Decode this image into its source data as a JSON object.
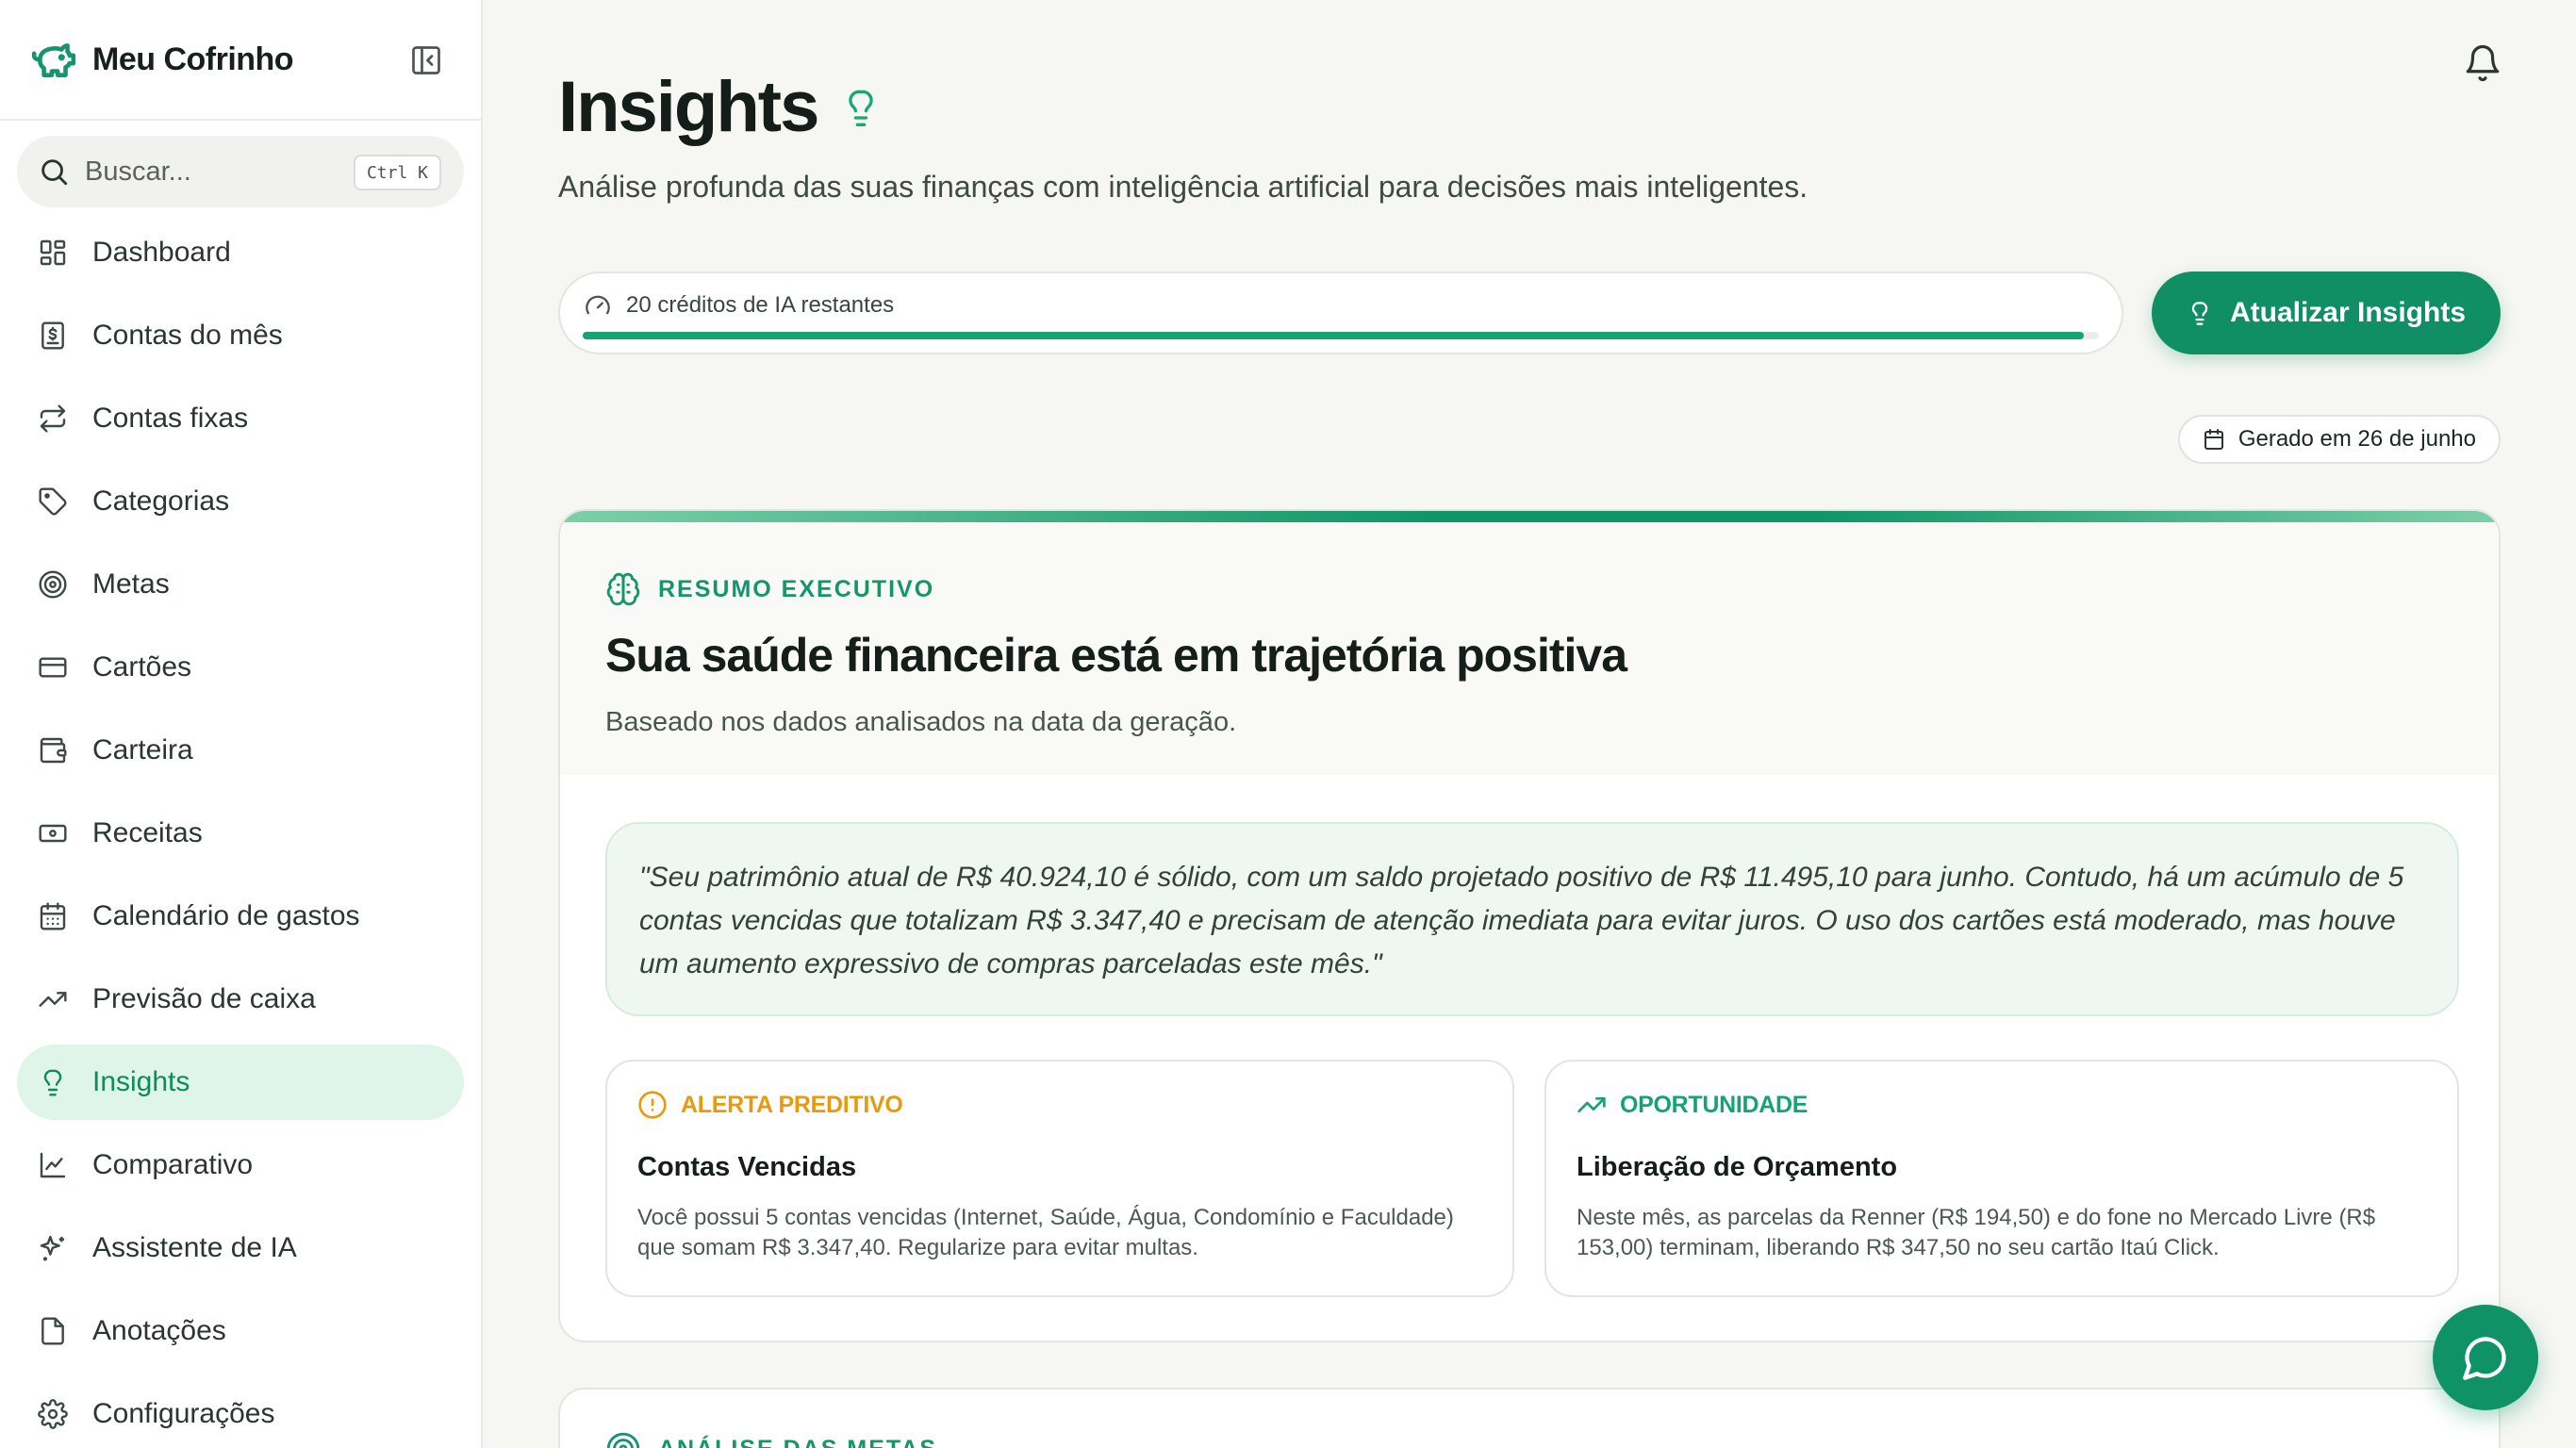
{
  "app": {
    "name": "Meu Cofrinho"
  },
  "search": {
    "placeholder": "Buscar...",
    "shortcut": "Ctrl K"
  },
  "sidebar": {
    "items": [
      {
        "label": "Dashboard",
        "icon": "dashboard-icon",
        "active": false
      },
      {
        "label": "Contas do mês",
        "icon": "receipt-icon",
        "active": false
      },
      {
        "label": "Contas fixas",
        "icon": "repeat-icon",
        "active": false
      },
      {
        "label": "Categorias",
        "icon": "tag-icon",
        "active": false
      },
      {
        "label": "Metas",
        "icon": "target-icon",
        "active": false
      },
      {
        "label": "Cartões",
        "icon": "credit-card-icon",
        "active": false
      },
      {
        "label": "Carteira",
        "icon": "wallet-icon",
        "active": false
      },
      {
        "label": "Receitas",
        "icon": "banknote-icon",
        "active": false
      },
      {
        "label": "Calendário de gastos",
        "icon": "calendar-icon",
        "active": false
      },
      {
        "label": "Previsão de caixa",
        "icon": "trending-up-icon",
        "active": false
      },
      {
        "label": "Insights",
        "icon": "lightbulb-icon",
        "active": true
      },
      {
        "label": "Comparativo",
        "icon": "line-chart-icon",
        "active": false
      },
      {
        "label": "Assistente de IA",
        "icon": "sparkles-icon",
        "active": false
      },
      {
        "label": "Anotações",
        "icon": "file-icon",
        "active": false
      },
      {
        "label": "Configurações",
        "icon": "gear-icon",
        "active": false
      }
    ]
  },
  "header": {
    "title": "Insights",
    "subtitle": "Análise profunda das suas finanças com inteligência artificial para decisões mais inteligentes."
  },
  "credits": {
    "label": "20 créditos de IA restantes",
    "fill_fraction": 0.99
  },
  "update_button": {
    "label": "Atualizar Insights"
  },
  "generated": {
    "label": "Gerado em 26 de junho"
  },
  "summary": {
    "kicker": "RESUMO EXECUTIVO",
    "title": "Sua saúde financeira está em trajetória positiva",
    "subtitle": "Baseado nos dados analisados na data da geração.",
    "quote": "\"Seu patrimônio atual de R$ 40.924,10 é sólido, com um saldo projetado positivo de R$ 11.495,10 para junho. Contudo, há um acúmulo de 5 contas vencidas que totalizam R$ 3.347,40 e precisam de atenção imediata para evitar juros. O uso dos cartões está moderado, mas houve um aumento expressivo de compras parceladas este mês.\"",
    "alert": {
      "tag": "ALERTA PREDITIVO",
      "title": "Contas Vencidas",
      "body": "Você possui 5 contas vencidas (Internet, Saúde, Água, Condomínio e Faculdade) que somam R$ 3.347,40. Regularize para evitar multas."
    },
    "opportunity": {
      "tag": "OPORTUNIDADE",
      "title": "Liberação de Orçamento",
      "body": "Neste mês, as parcelas da Renner (R$ 194,50) e do fone no Mercado Livre (R$ 153,00) terminam, liberando R$ 347,50 no seu cartão Itaú Click."
    }
  },
  "goals_card": {
    "kicker": "ANÁLISE DAS METAS"
  },
  "colors": {
    "brand": "#0f8f63",
    "active_bg": "#dff5ea",
    "warning": "#e89a0c"
  }
}
